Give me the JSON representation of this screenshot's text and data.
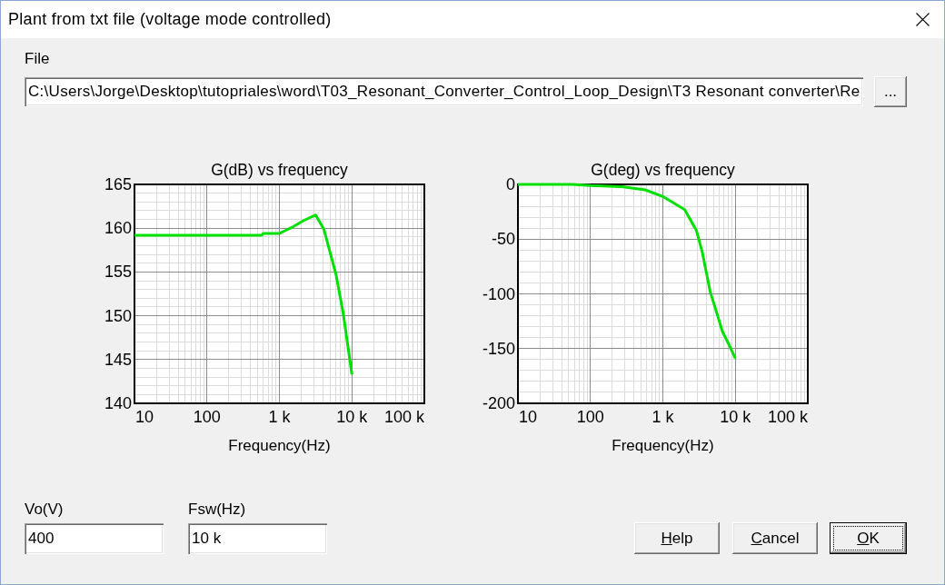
{
  "window": {
    "title": "Plant from txt file (voltage mode controlled)"
  },
  "file": {
    "label": "File",
    "value": "C:\\Users\\Jorge\\Desktop\\tutopriales\\word\\T03_Resonant_Converter_Control_Loop_Design\\T3 Resonant converter\\Re",
    "browse_button": {
      "label": "..."
    }
  },
  "plots": [
    {
      "chart_data": {
        "type": "line",
        "title": "G(dB) vs frequency",
        "xlabel": "Frequency(Hz)",
        "log": "x",
        "grid": true,
        "xlim": [
          10,
          100000
        ],
        "ylim": [
          140,
          165
        ],
        "xticks": [
          {
            "value": 10,
            "label": "10"
          },
          {
            "value": 100,
            "label": "100"
          },
          {
            "value": 1000,
            "label": "1 k"
          },
          {
            "value": 10000,
            "label": "10 k"
          },
          {
            "value": 100000,
            "label": "100 k"
          }
        ],
        "yticks": [
          140,
          145,
          150,
          155,
          160,
          165
        ],
        "x": [
          10,
          570,
          600,
          1000,
          1500,
          2200,
          3160,
          4100,
          6000,
          7600,
          10000
        ],
        "values": [
          159.2,
          159.2,
          159.4,
          159.4,
          160.1,
          160.9,
          161.5,
          159.9,
          154.8,
          150.3,
          143.3
        ],
        "color": "#00e000"
      }
    },
    {
      "chart_data": {
        "type": "line",
        "title": "G(deg) vs frequency",
        "xlabel": "Frequency(Hz)",
        "log": "x",
        "grid": true,
        "xlim": [
          10,
          100000
        ],
        "ylim": [
          -200,
          0
        ],
        "xticks": [
          {
            "value": 10,
            "label": "10"
          },
          {
            "value": 100,
            "label": "100"
          },
          {
            "value": 1000,
            "label": "1 k"
          },
          {
            "value": 10000,
            "label": "10 k"
          },
          {
            "value": 100000,
            "label": "100 k"
          }
        ],
        "yticks": [
          -200,
          -150,
          -100,
          -50,
          0
        ],
        "x": [
          10,
          56,
          100,
          270,
          570,
          1000,
          2000,
          2900,
          3500,
          4500,
          5700,
          6600,
          8400,
          10000
        ],
        "values": [
          0,
          0,
          -1,
          -2,
          -5,
          -11,
          -23,
          -42,
          -62,
          -98,
          -120,
          -134,
          -148,
          -159
        ],
        "color": "#00e000"
      }
    }
  ],
  "fields": [
    {
      "label": "Vo(V)",
      "value": "400"
    },
    {
      "label": "Fsw(Hz)",
      "value": "10 k"
    }
  ],
  "buttons": [
    {
      "label": "Help",
      "default": false,
      "access_key_underlined": true
    },
    {
      "label": "Cancel",
      "default": false,
      "access_key_underlined": true
    },
    {
      "label": "OK",
      "default": true,
      "access_key_underlined": true
    }
  ]
}
